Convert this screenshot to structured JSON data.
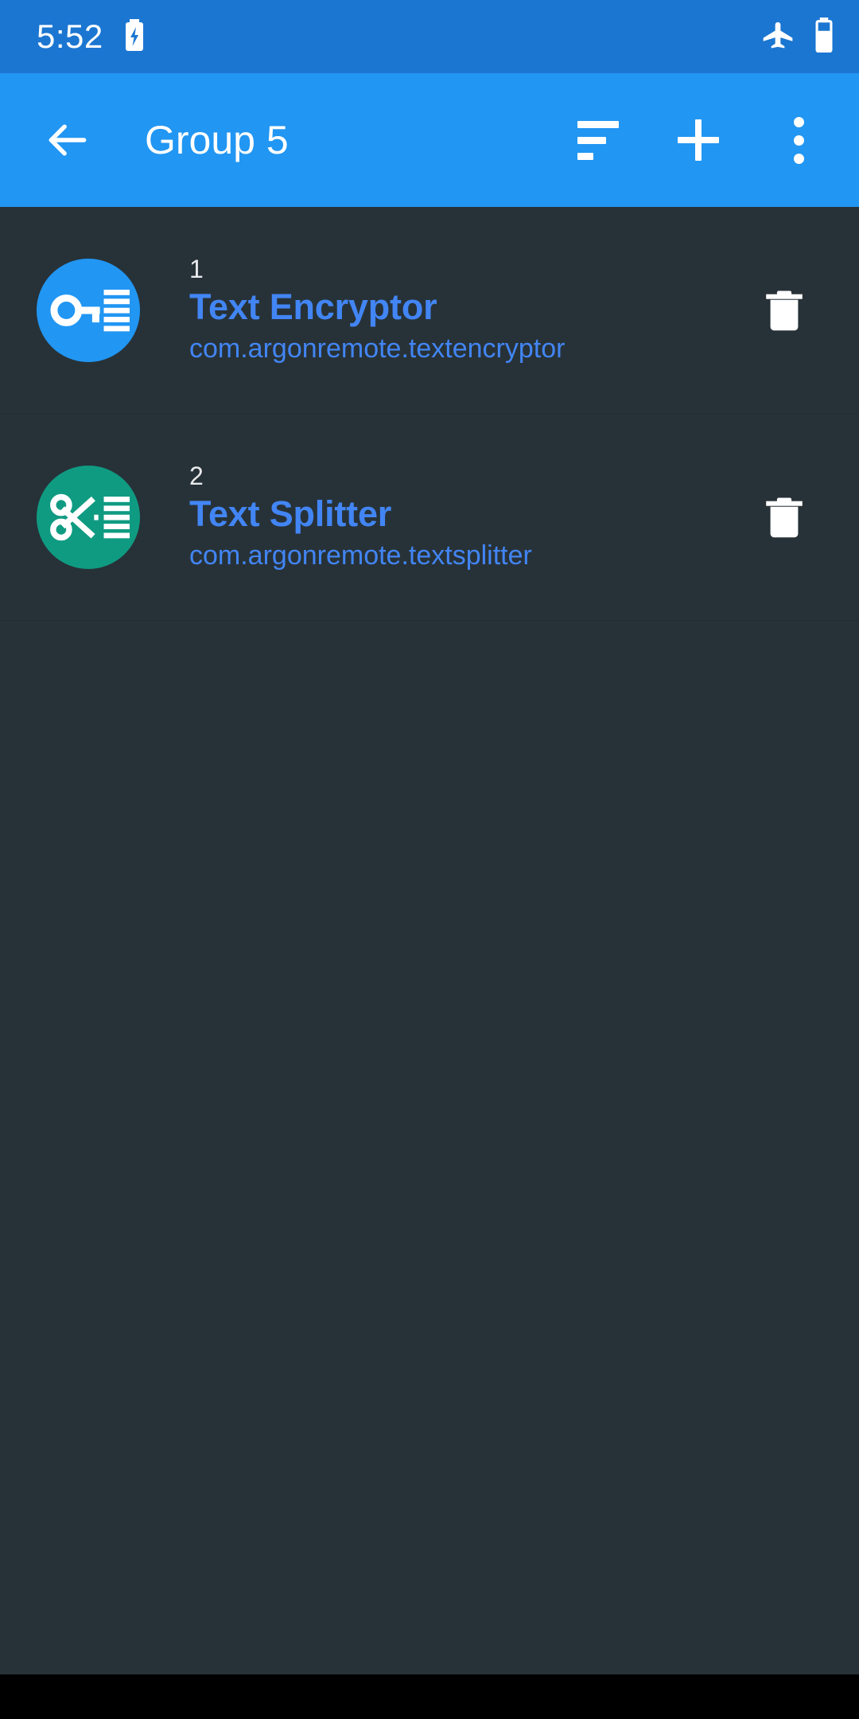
{
  "status_bar": {
    "clock": "5:52",
    "icons": {
      "charging": "charging-battery-icon",
      "airplane": "airplane-mode-icon",
      "battery": "battery-icon"
    },
    "background": "#1b76d2"
  },
  "app_bar": {
    "title": "Group 5",
    "background": "#2196f3",
    "back_label": "back-arrow",
    "actions": [
      {
        "name": "sort",
        "label": "Sort"
      },
      {
        "name": "add",
        "label": "Add"
      },
      {
        "name": "overflow",
        "label": "More options"
      }
    ]
  },
  "list": {
    "items": [
      {
        "index": "1",
        "name": "Text Encryptor",
        "package": "com.argonremote.textencryptor",
        "icon_name": "key-document-icon",
        "icon_bg": "#2196f3",
        "delete_label": "Delete"
      },
      {
        "index": "2",
        "name": "Text Splitter",
        "package": "com.argonremote.textsplitter",
        "icon_name": "scissors-document-icon",
        "icon_bg": "#0f9b82",
        "delete_label": "Delete"
      }
    ]
  },
  "theme": {
    "background": "#273238",
    "accent": "#4285f4",
    "divider": "#222c32",
    "primary_text": "#e8eaec"
  }
}
